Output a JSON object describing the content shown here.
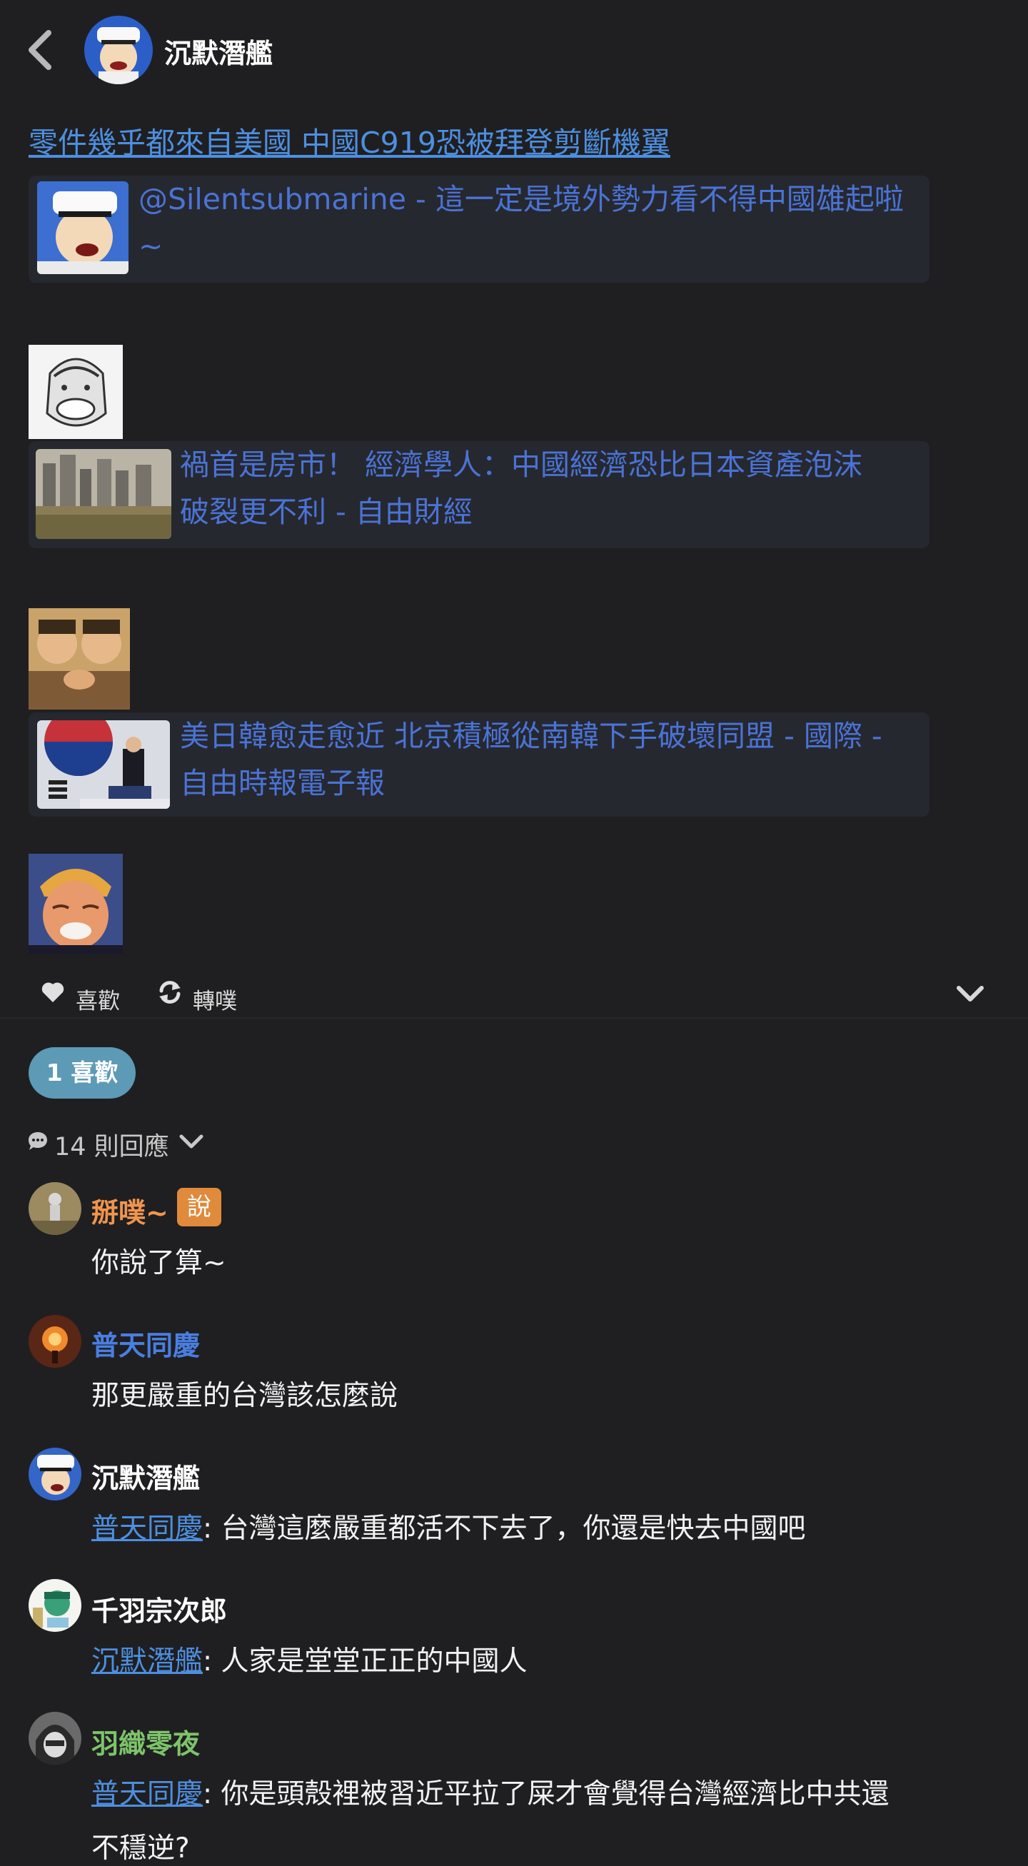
{
  "header": {
    "poster_name": "沉默潛艦"
  },
  "post": {
    "title_link": "零件幾乎都來自美國 中國C919恐被拜登剪斷機翼",
    "cards": [
      {
        "line1": "@Silentsubmarine - 這一定是境外勢力看不得中國雄起啦",
        "line2": "~"
      },
      {
        "line1": "禍首是房市！ 經濟學人：中國經濟恐比日本資產泡沫",
        "line2": "破裂更不利 - 自由財經"
      },
      {
        "line1": "美日韓愈走愈近 北京積極從南韓下手破壞同盟 - 國際 -",
        "line2": "自由時報電子報"
      }
    ]
  },
  "actions": {
    "like_label": "喜歡",
    "replurk_label": "轉噗"
  },
  "likes": {
    "label": "1 喜歡"
  },
  "replies": {
    "count_label": "14 則回應"
  },
  "comments": [
    {
      "name": "掰噗~",
      "name_color": "#f0954e",
      "badge": "說",
      "text": "你說了算~"
    },
    {
      "name": "普天同慶",
      "name_color": "#4a7ee0",
      "text": "那更嚴重的台灣該怎麼說"
    },
    {
      "name": "沉默潛艦",
      "name_color": "#ffffff",
      "mention": "普天同慶",
      "text": ": 台灣這麼嚴重都活不下去了，你還是快去中國吧"
    },
    {
      "name": "千羽宗次郎",
      "name_color": "#ffffff",
      "mention": "沉默潛艦",
      "text": ": 人家是堂堂正正的中國人"
    },
    {
      "name": "羽織零夜",
      "name_color": "#7dc46a",
      "mention": "普天同慶",
      "text": ": 你是頭殼裡被習近平拉了屎才會覺得台灣經濟比中共還",
      "text2": "不穩逆?"
    }
  ]
}
